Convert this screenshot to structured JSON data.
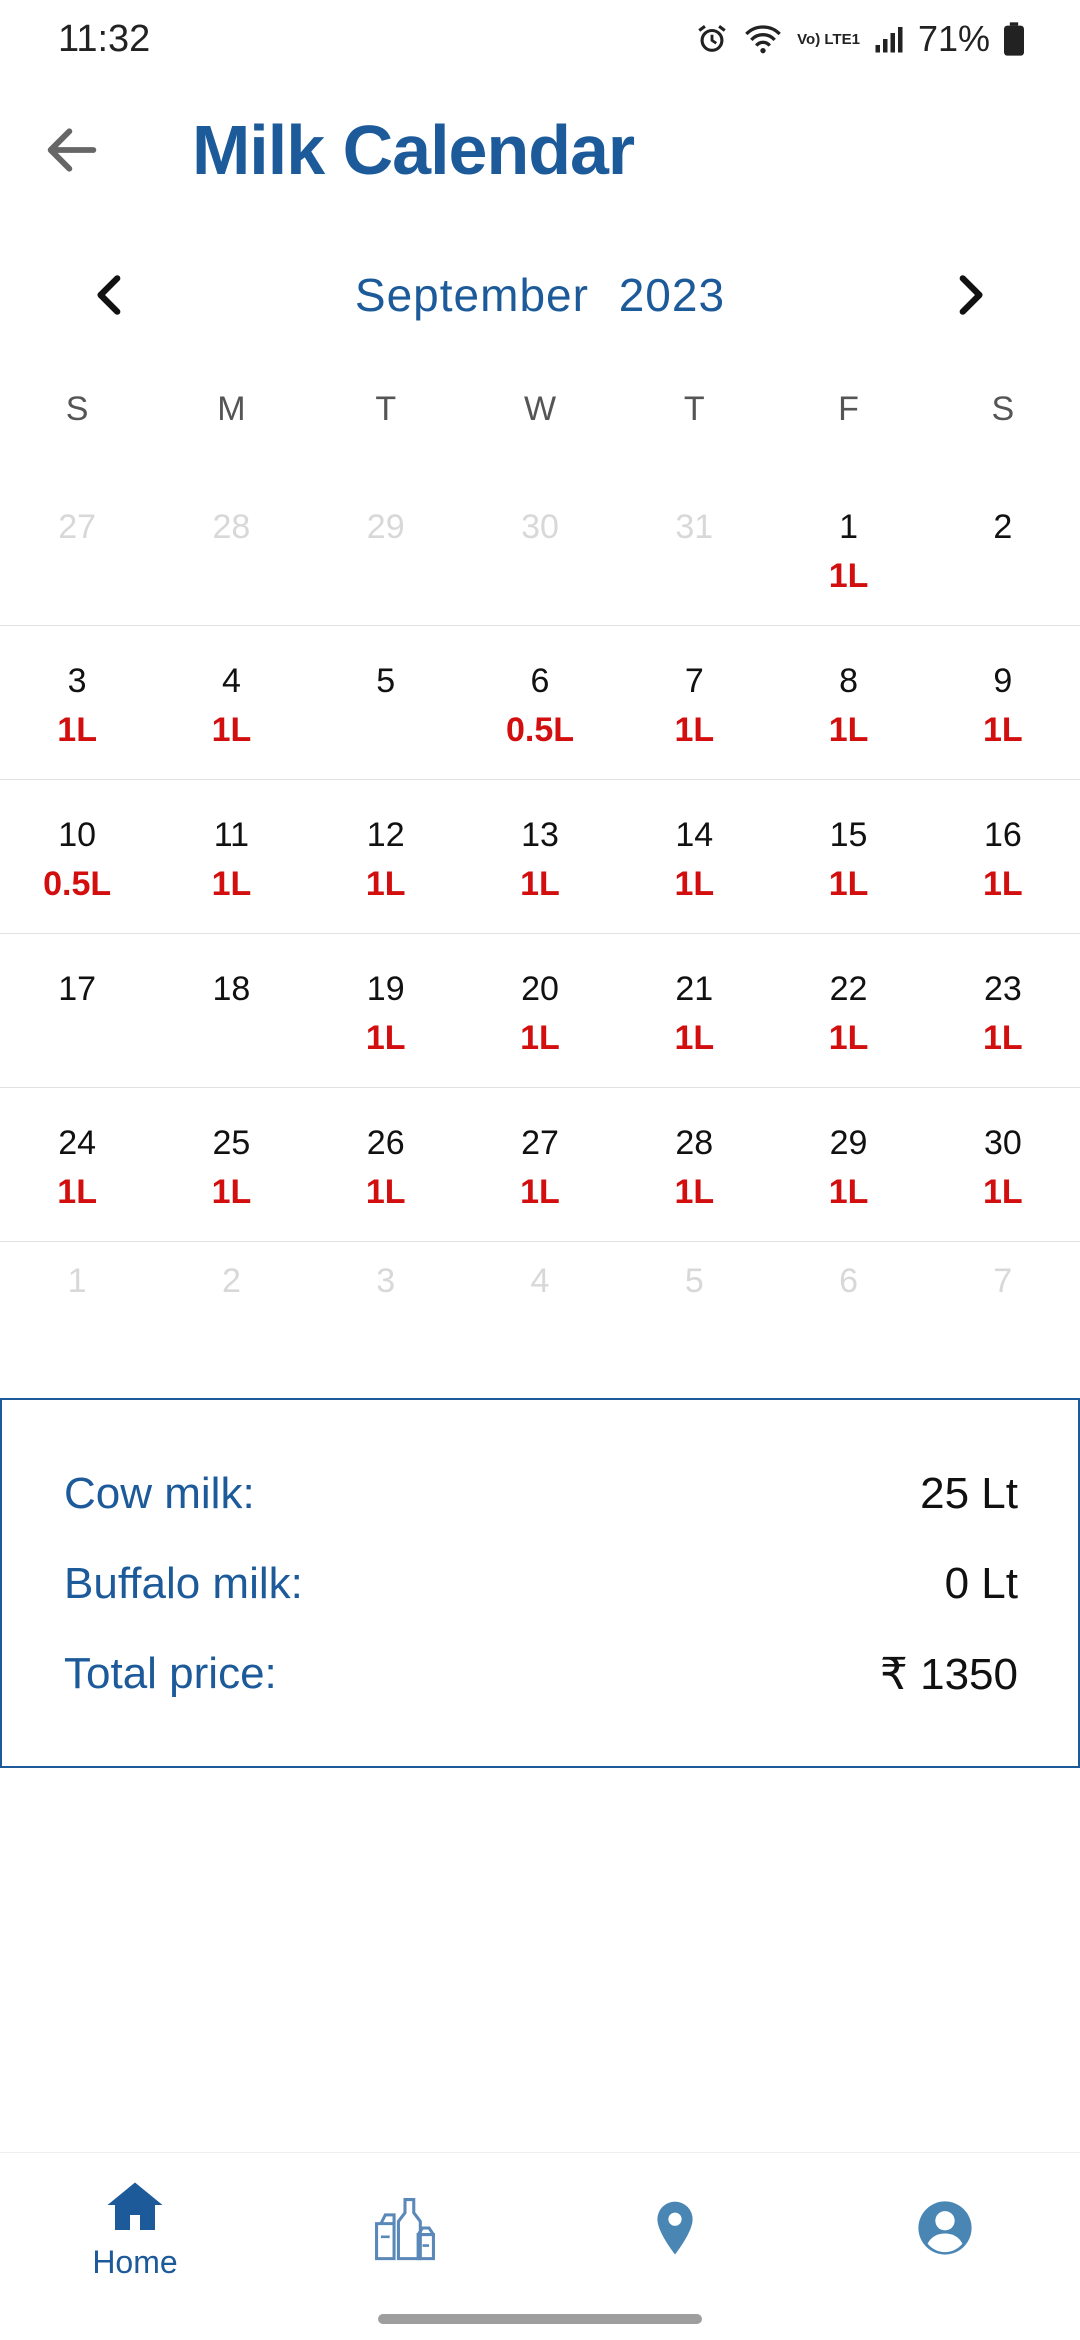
{
  "status_bar": {
    "time": "11:32",
    "network": "Vo) LTE1",
    "battery": "71%"
  },
  "app_bar": {
    "title": "Milk Calendar"
  },
  "month_nav": {
    "month": "September",
    "year": "2023"
  },
  "weekdays": [
    "S",
    "M",
    "T",
    "W",
    "T",
    "F",
    "S"
  ],
  "weeks": [
    [
      {
        "day": "27",
        "qty": "",
        "dim": true
      },
      {
        "day": "28",
        "qty": "",
        "dim": true
      },
      {
        "day": "29",
        "qty": "",
        "dim": true
      },
      {
        "day": "30",
        "qty": "",
        "dim": true
      },
      {
        "day": "31",
        "qty": "",
        "dim": true
      },
      {
        "day": "1",
        "qty": "1L",
        "dim": false
      },
      {
        "day": "2",
        "qty": "",
        "dim": false
      }
    ],
    [
      {
        "day": "3",
        "qty": "1L",
        "dim": false
      },
      {
        "day": "4",
        "qty": "1L",
        "dim": false
      },
      {
        "day": "5",
        "qty": "",
        "dim": false
      },
      {
        "day": "6",
        "qty": "0.5L",
        "dim": false
      },
      {
        "day": "7",
        "qty": "1L",
        "dim": false
      },
      {
        "day": "8",
        "qty": "1L",
        "dim": false
      },
      {
        "day": "9",
        "qty": "1L",
        "dim": false
      }
    ],
    [
      {
        "day": "10",
        "qty": "0.5L",
        "dim": false
      },
      {
        "day": "11",
        "qty": "1L",
        "dim": false
      },
      {
        "day": "12",
        "qty": "1L",
        "dim": false
      },
      {
        "day": "13",
        "qty": "1L",
        "dim": false
      },
      {
        "day": "14",
        "qty": "1L",
        "dim": false
      },
      {
        "day": "15",
        "qty": "1L",
        "dim": false
      },
      {
        "day": "16",
        "qty": "1L",
        "dim": false
      }
    ],
    [
      {
        "day": "17",
        "qty": "",
        "dim": false
      },
      {
        "day": "18",
        "qty": "",
        "dim": false
      },
      {
        "day": "19",
        "qty": "1L",
        "dim": false
      },
      {
        "day": "20",
        "qty": "1L",
        "dim": false
      },
      {
        "day": "21",
        "qty": "1L",
        "dim": false
      },
      {
        "day": "22",
        "qty": "1L",
        "dim": false
      },
      {
        "day": "23",
        "qty": "1L",
        "dim": false
      }
    ],
    [
      {
        "day": "24",
        "qty": "1L",
        "dim": false
      },
      {
        "day": "25",
        "qty": "1L",
        "dim": false
      },
      {
        "day": "26",
        "qty": "1L",
        "dim": false
      },
      {
        "day": "27",
        "qty": "1L",
        "dim": false
      },
      {
        "day": "28",
        "qty": "1L",
        "dim": false
      },
      {
        "day": "29",
        "qty": "1L",
        "dim": false
      },
      {
        "day": "30",
        "qty": "1L",
        "dim": false
      }
    ],
    [
      {
        "day": "1",
        "qty": "",
        "dim": true
      },
      {
        "day": "2",
        "qty": "",
        "dim": true
      },
      {
        "day": "3",
        "qty": "",
        "dim": true
      },
      {
        "day": "4",
        "qty": "",
        "dim": true
      },
      {
        "day": "5",
        "qty": "",
        "dim": true
      },
      {
        "day": "6",
        "qty": "",
        "dim": true
      },
      {
        "day": "7",
        "qty": "",
        "dim": true
      }
    ]
  ],
  "summary": {
    "cow_label": "Cow milk:",
    "cow_value": "25 Lt",
    "buffalo_label": "Buffalo milk:",
    "buffalo_value": "0 Lt",
    "total_label": "Total price:",
    "total_value": "₹ 1350"
  },
  "bottom_nav": {
    "home_label": "Home",
    "active": "home"
  },
  "colors": {
    "primary": "#1d5a9a",
    "quantity": "#d20e0e",
    "muted_day": "#d8d8d8"
  }
}
